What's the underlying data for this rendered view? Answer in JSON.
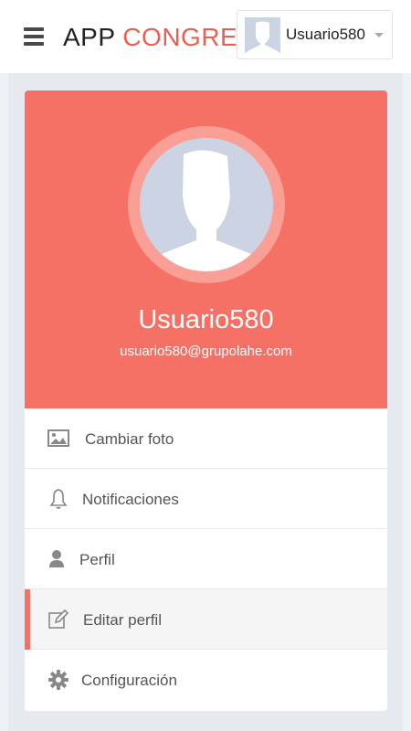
{
  "header": {
    "brand_part1": "APP ",
    "brand_part2": "CONGRESS",
    "user_name": "Usuario580"
  },
  "profile": {
    "name": "Usuario580",
    "email": "usuario580@grupolahe.com"
  },
  "menu": [
    {
      "label": "Cambiar foto",
      "icon": "image-icon",
      "active": false
    },
    {
      "label": "Notificaciones",
      "icon": "bell-icon",
      "active": false
    },
    {
      "label": "Perfil",
      "icon": "user-icon",
      "active": false
    },
    {
      "label": "Editar perfil",
      "icon": "edit-icon",
      "active": true
    },
    {
      "label": "Configuración",
      "icon": "gear-icon",
      "active": false
    }
  ],
  "colors": {
    "accent": "#f57165",
    "brand_accent": "#ec5f52",
    "avatar_ring": "#fa9f96"
  }
}
